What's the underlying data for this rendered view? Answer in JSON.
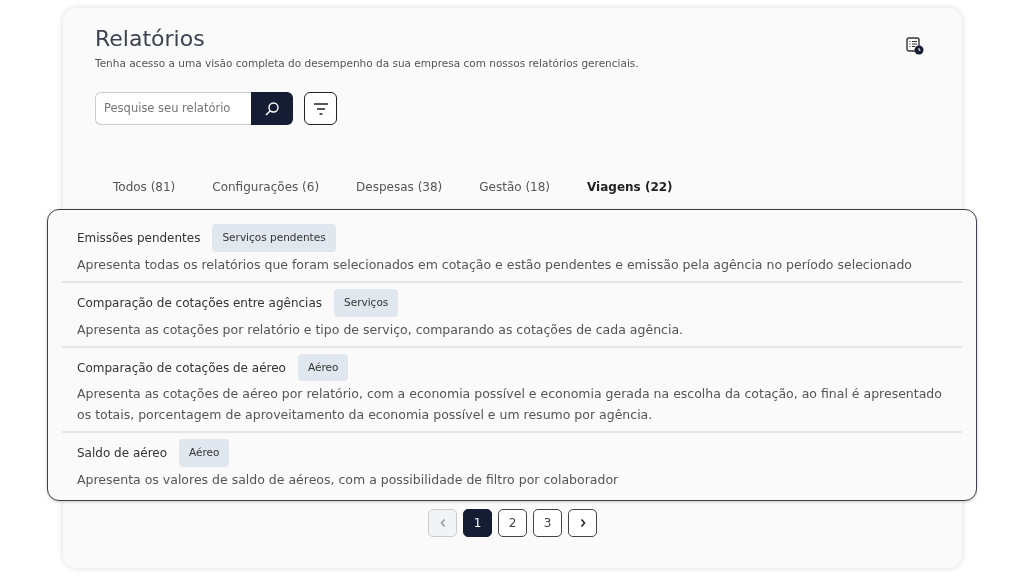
{
  "header": {
    "title": "Relatórios",
    "subtitle": "Tenha acesso a uma visão completa do desempenho da sua empresa com nossos relatórios gerenciais."
  },
  "search": {
    "placeholder": "Pesquise seu relatório"
  },
  "tabs": [
    {
      "label": "Todos (81)",
      "selected": false
    },
    {
      "label": "Configurações (6)",
      "selected": false
    },
    {
      "label": "Despesas (38)",
      "selected": false
    },
    {
      "label": "Gestão (18)",
      "selected": false
    },
    {
      "label": "Viagens (22)",
      "selected": true
    }
  ],
  "reports": [
    {
      "title": "Emissões pendentes",
      "tag": "Serviços pendentes",
      "description": "Apresenta todas os relatórios que foram selecionados em cotação e estão pendentes e emissão pela agência no período selecionado"
    },
    {
      "title": "Comparação de cotações entre agências",
      "tag": "Serviços",
      "description": "Apresenta as cotações por relatório e tipo de serviço, comparando as cotações de cada agência."
    },
    {
      "title": "Comparação de cotações de aéreo",
      "tag": "Aéreo",
      "description": "Apresenta as cotações de aéreo por relatório, com a economia possível e economia gerada na escolha da cotação, ao final é apresentado os totais, porcentagem de aproveitamento da economia possível e um resumo por agência."
    },
    {
      "title": "Saldo de aéreo",
      "tag": "Aéreo",
      "description": "Apresenta os valores de saldo de aéreos, com a possibilidade de filtro por colaborador"
    }
  ],
  "pagination": {
    "previous_disabled": true,
    "pages": [
      {
        "label": "1",
        "selected": true
      },
      {
        "label": "2",
        "selected": false
      },
      {
        "label": "3",
        "selected": false
      }
    ]
  }
}
